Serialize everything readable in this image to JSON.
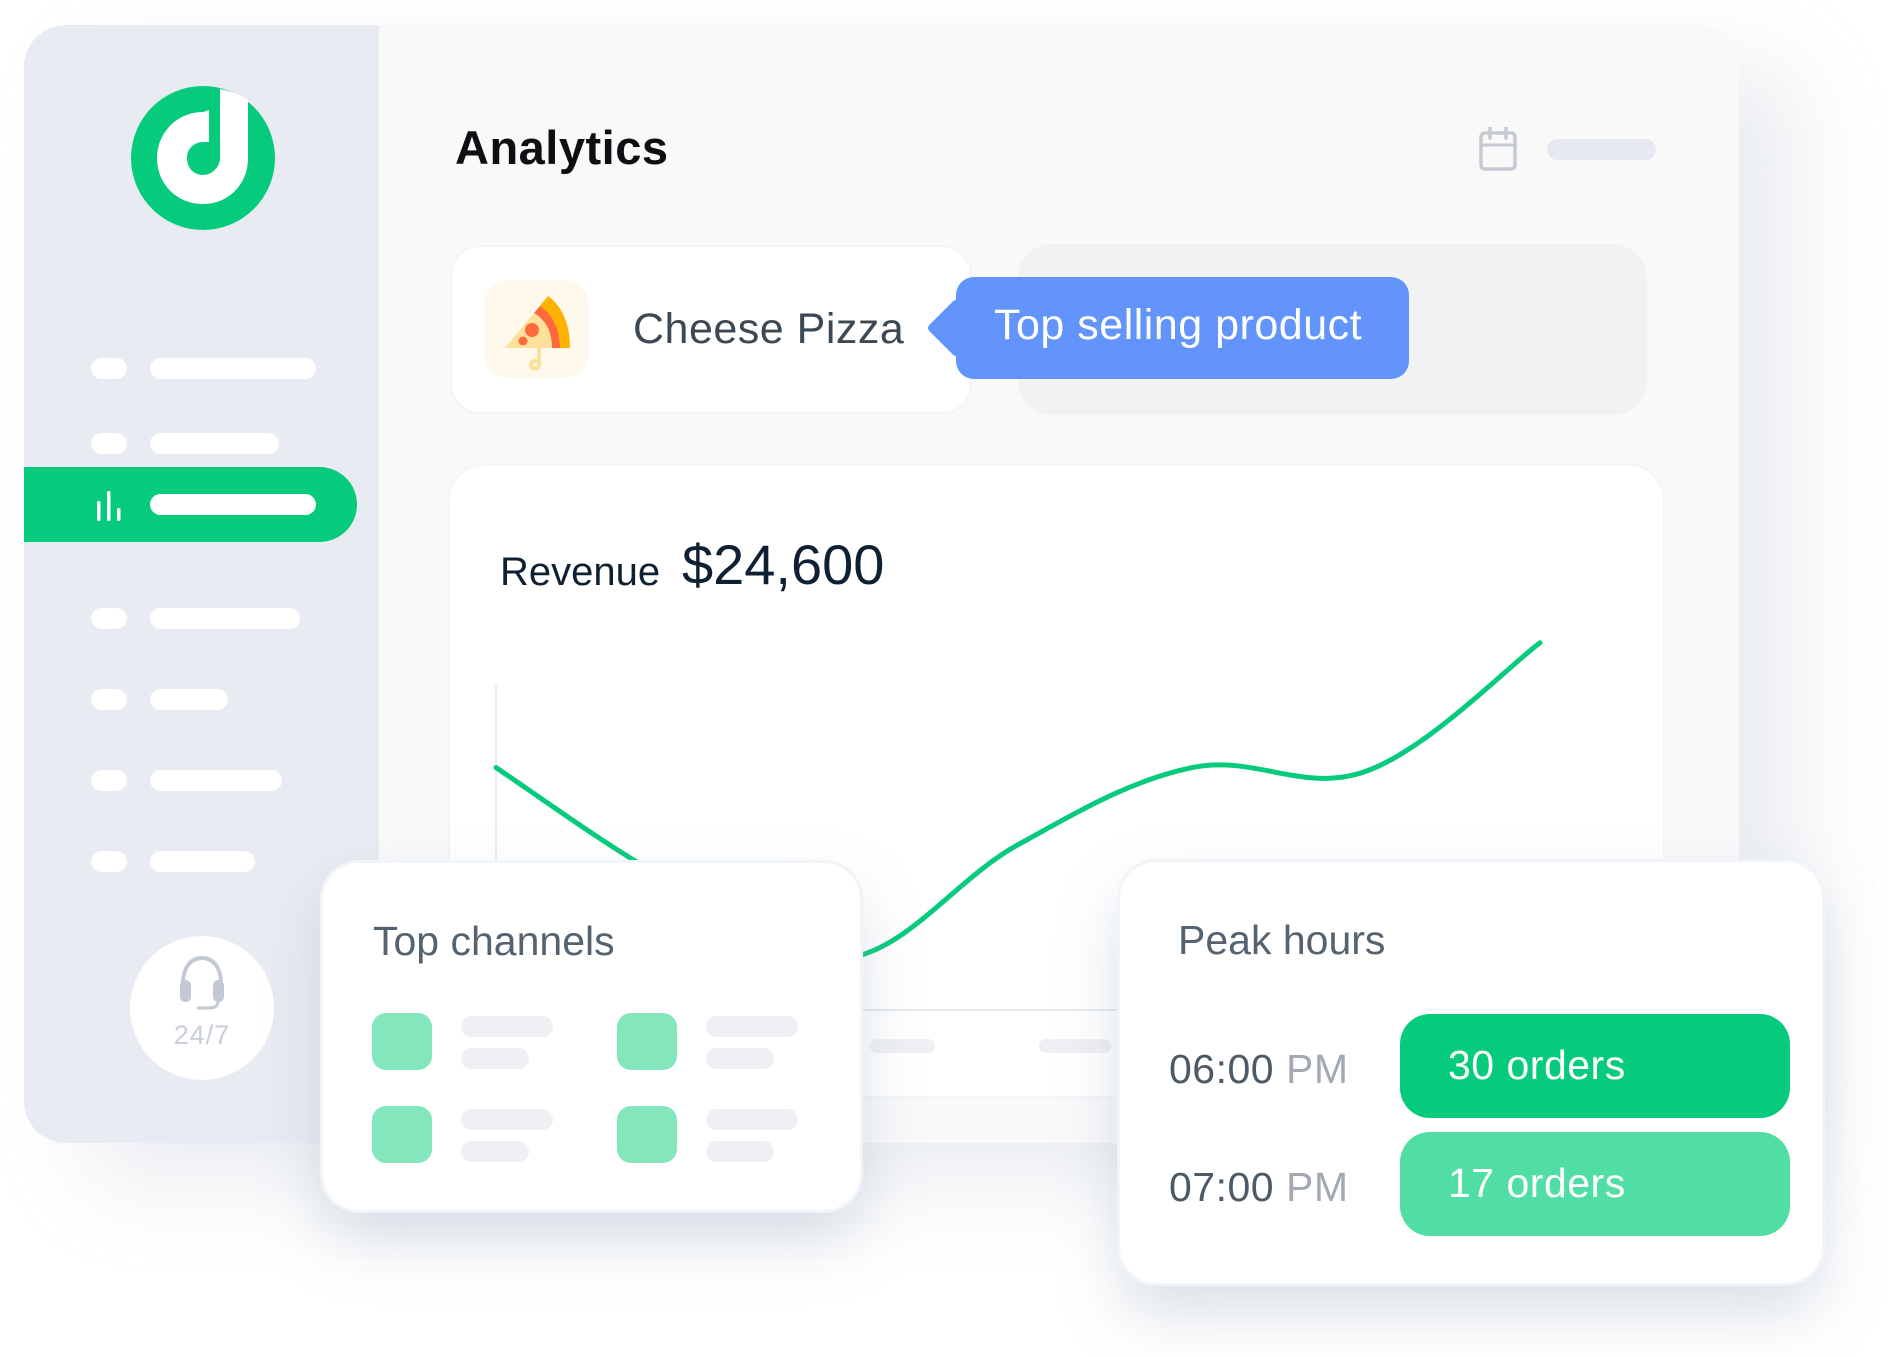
{
  "app": {
    "brand_color": "#07cb7c",
    "logo_icon": "music-note-circle-logo"
  },
  "sidebar": {
    "items": [
      {
        "icon": "placeholder-icon",
        "label_placeholder": true,
        "active": false
      },
      {
        "icon": "placeholder-icon",
        "label_placeholder": true,
        "active": false
      },
      {
        "icon": "bar-chart-icon",
        "label_placeholder": true,
        "active": true
      },
      {
        "icon": "placeholder-icon",
        "label_placeholder": true,
        "active": false
      },
      {
        "icon": "placeholder-icon",
        "label_placeholder": true,
        "active": false
      },
      {
        "icon": "placeholder-icon",
        "label_placeholder": true,
        "active": false
      },
      {
        "icon": "placeholder-icon",
        "label_placeholder": true,
        "active": false
      }
    ],
    "support": {
      "icon": "headset-icon",
      "label": "24/7"
    }
  },
  "header": {
    "title": "Analytics",
    "date_icon": "calendar-icon"
  },
  "top_product": {
    "icon": "pizza-icon",
    "name": "Cheese Pizza",
    "tooltip": "Top selling product",
    "tooltip_color": "#6294fc"
  },
  "revenue": {
    "label": "Revenue",
    "value": "$24,600",
    "line_color": "#07cb7c"
  },
  "chart_data": {
    "type": "line",
    "title": "Revenue $24,600",
    "xlabel": "",
    "ylabel": "",
    "x": [
      0,
      1,
      2,
      3,
      4,
      5,
      6
    ],
    "series": [
      {
        "name": "Revenue",
        "values": [
          66,
          35,
          14,
          45,
          66,
          65,
          100
        ]
      }
    ],
    "ylim": [
      0,
      110
    ],
    "grid": false,
    "legend": "none"
  },
  "top_channels": {
    "title": "Top channels",
    "items_count": 4
  },
  "peak_hours": {
    "title": "Peak hours",
    "rows": [
      {
        "time": "06:00",
        "period": "PM",
        "orders": "30 orders",
        "color": "#07cb7c"
      },
      {
        "time": "07:00",
        "period": "PM",
        "orders": "17 orders",
        "color": "#50dea5"
      }
    ]
  }
}
